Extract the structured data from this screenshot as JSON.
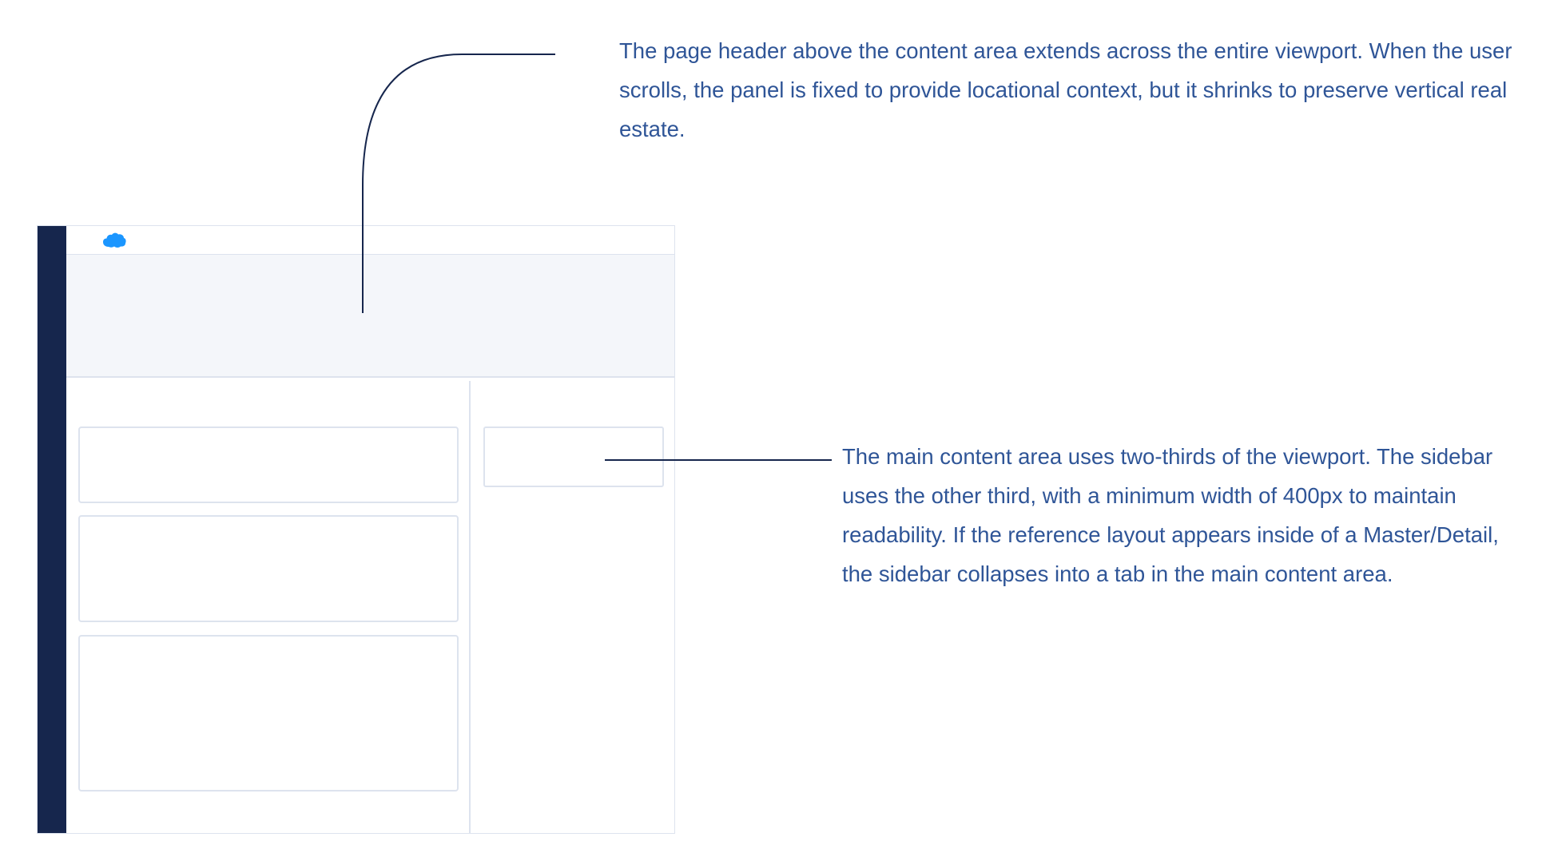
{
  "annotations": {
    "page_header": "The page header above the content area extends across the entire viewport. When the user scrolls, the panel is fixed to provide locational context, but it shrinks to preserve vertical real estate.",
    "main_content": "The main content area uses two-thirds of the viewport. The sidebar uses the other third, with a minimum width of 400px to maintain readability. If the reference layout appears inside of a Master/Detail, the sidebar collapses into a tab in the main content area."
  },
  "wireframe": {
    "logo_icon": "cloud-logo-icon",
    "cards": [
      "card-1",
      "card-2",
      "card-3"
    ],
    "sidebar_cards": [
      "side-card-1"
    ]
  },
  "colors": {
    "nav_bar": "#16264d",
    "page_header_bg": "#f4f6fa",
    "border": "#dde3ee",
    "annotation_text": "#2f5597",
    "leader_line": "#16264d",
    "logo": "#1b96ff"
  }
}
